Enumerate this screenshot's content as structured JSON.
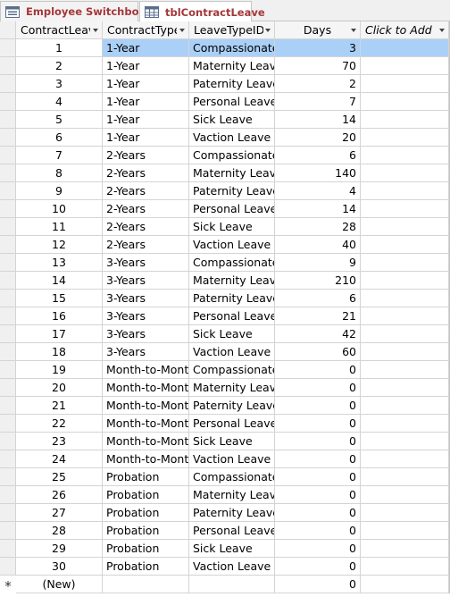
{
  "tabs": [
    {
      "label": "Employee Switchboard",
      "icon": "form-icon"
    },
    {
      "label": "tblContractLeave",
      "icon": "table-icon",
      "active": true
    }
  ],
  "columns": [
    "ContractLeaveID",
    "ContractType",
    "LeaveTypeID",
    "Days",
    "Click to Add"
  ],
  "rows": [
    [
      "1",
      "1-Year",
      "Compassionate",
      "3"
    ],
    [
      "2",
      "1-Year",
      "Maternity Leave",
      "70"
    ],
    [
      "3",
      "1-Year",
      "Paternity Leave",
      "2"
    ],
    [
      "4",
      "1-Year",
      "Personal Leave",
      "7"
    ],
    [
      "5",
      "1-Year",
      "Sick Leave",
      "14"
    ],
    [
      "6",
      "1-Year",
      "Vaction Leave",
      "20"
    ],
    [
      "7",
      "2-Years",
      "Compassionate",
      "6"
    ],
    [
      "8",
      "2-Years",
      "Maternity Leave",
      "140"
    ],
    [
      "9",
      "2-Years",
      "Paternity Leave",
      "4"
    ],
    [
      "10",
      "2-Years",
      "Personal Leave",
      "14"
    ],
    [
      "11",
      "2-Years",
      "Sick Leave",
      "28"
    ],
    [
      "12",
      "2-Years",
      "Vaction Leave",
      "40"
    ],
    [
      "13",
      "3-Years",
      "Compassionate",
      "9"
    ],
    [
      "14",
      "3-Years",
      "Maternity Leave",
      "210"
    ],
    [
      "15",
      "3-Years",
      "Paternity Leave",
      "6"
    ],
    [
      "16",
      "3-Years",
      "Personal Leave",
      "21"
    ],
    [
      "17",
      "3-Years",
      "Sick Leave",
      "42"
    ],
    [
      "18",
      "3-Years",
      "Vaction Leave",
      "60"
    ],
    [
      "19",
      "Month-to-Month",
      "Compassionate",
      "0"
    ],
    [
      "20",
      "Month-to-Month",
      "Maternity Leave",
      "0"
    ],
    [
      "21",
      "Month-to-Month",
      "Paternity Leave",
      "0"
    ],
    [
      "22",
      "Month-to-Month",
      "Personal Leave",
      "0"
    ],
    [
      "23",
      "Month-to-Month",
      "Sick Leave",
      "0"
    ],
    [
      "24",
      "Month-to-Month",
      "Vaction Leave",
      "0"
    ],
    [
      "25",
      "Probation",
      "Compassionate",
      "0"
    ],
    [
      "26",
      "Probation",
      "Maternity Leave",
      "0"
    ],
    [
      "27",
      "Probation",
      "Paternity Leave",
      "0"
    ],
    [
      "28",
      "Probation",
      "Personal Leave",
      "0"
    ],
    [
      "29",
      "Probation",
      "Sick Leave",
      "0"
    ],
    [
      "30",
      "Probation",
      "Vaction Leave",
      "0"
    ]
  ],
  "new_row": {
    "marker": "*",
    "id": "(New)",
    "days": "0"
  },
  "selected_row": 1,
  "colors": {
    "tab_text": "#a4373a",
    "selection": "#abd0f7"
  }
}
